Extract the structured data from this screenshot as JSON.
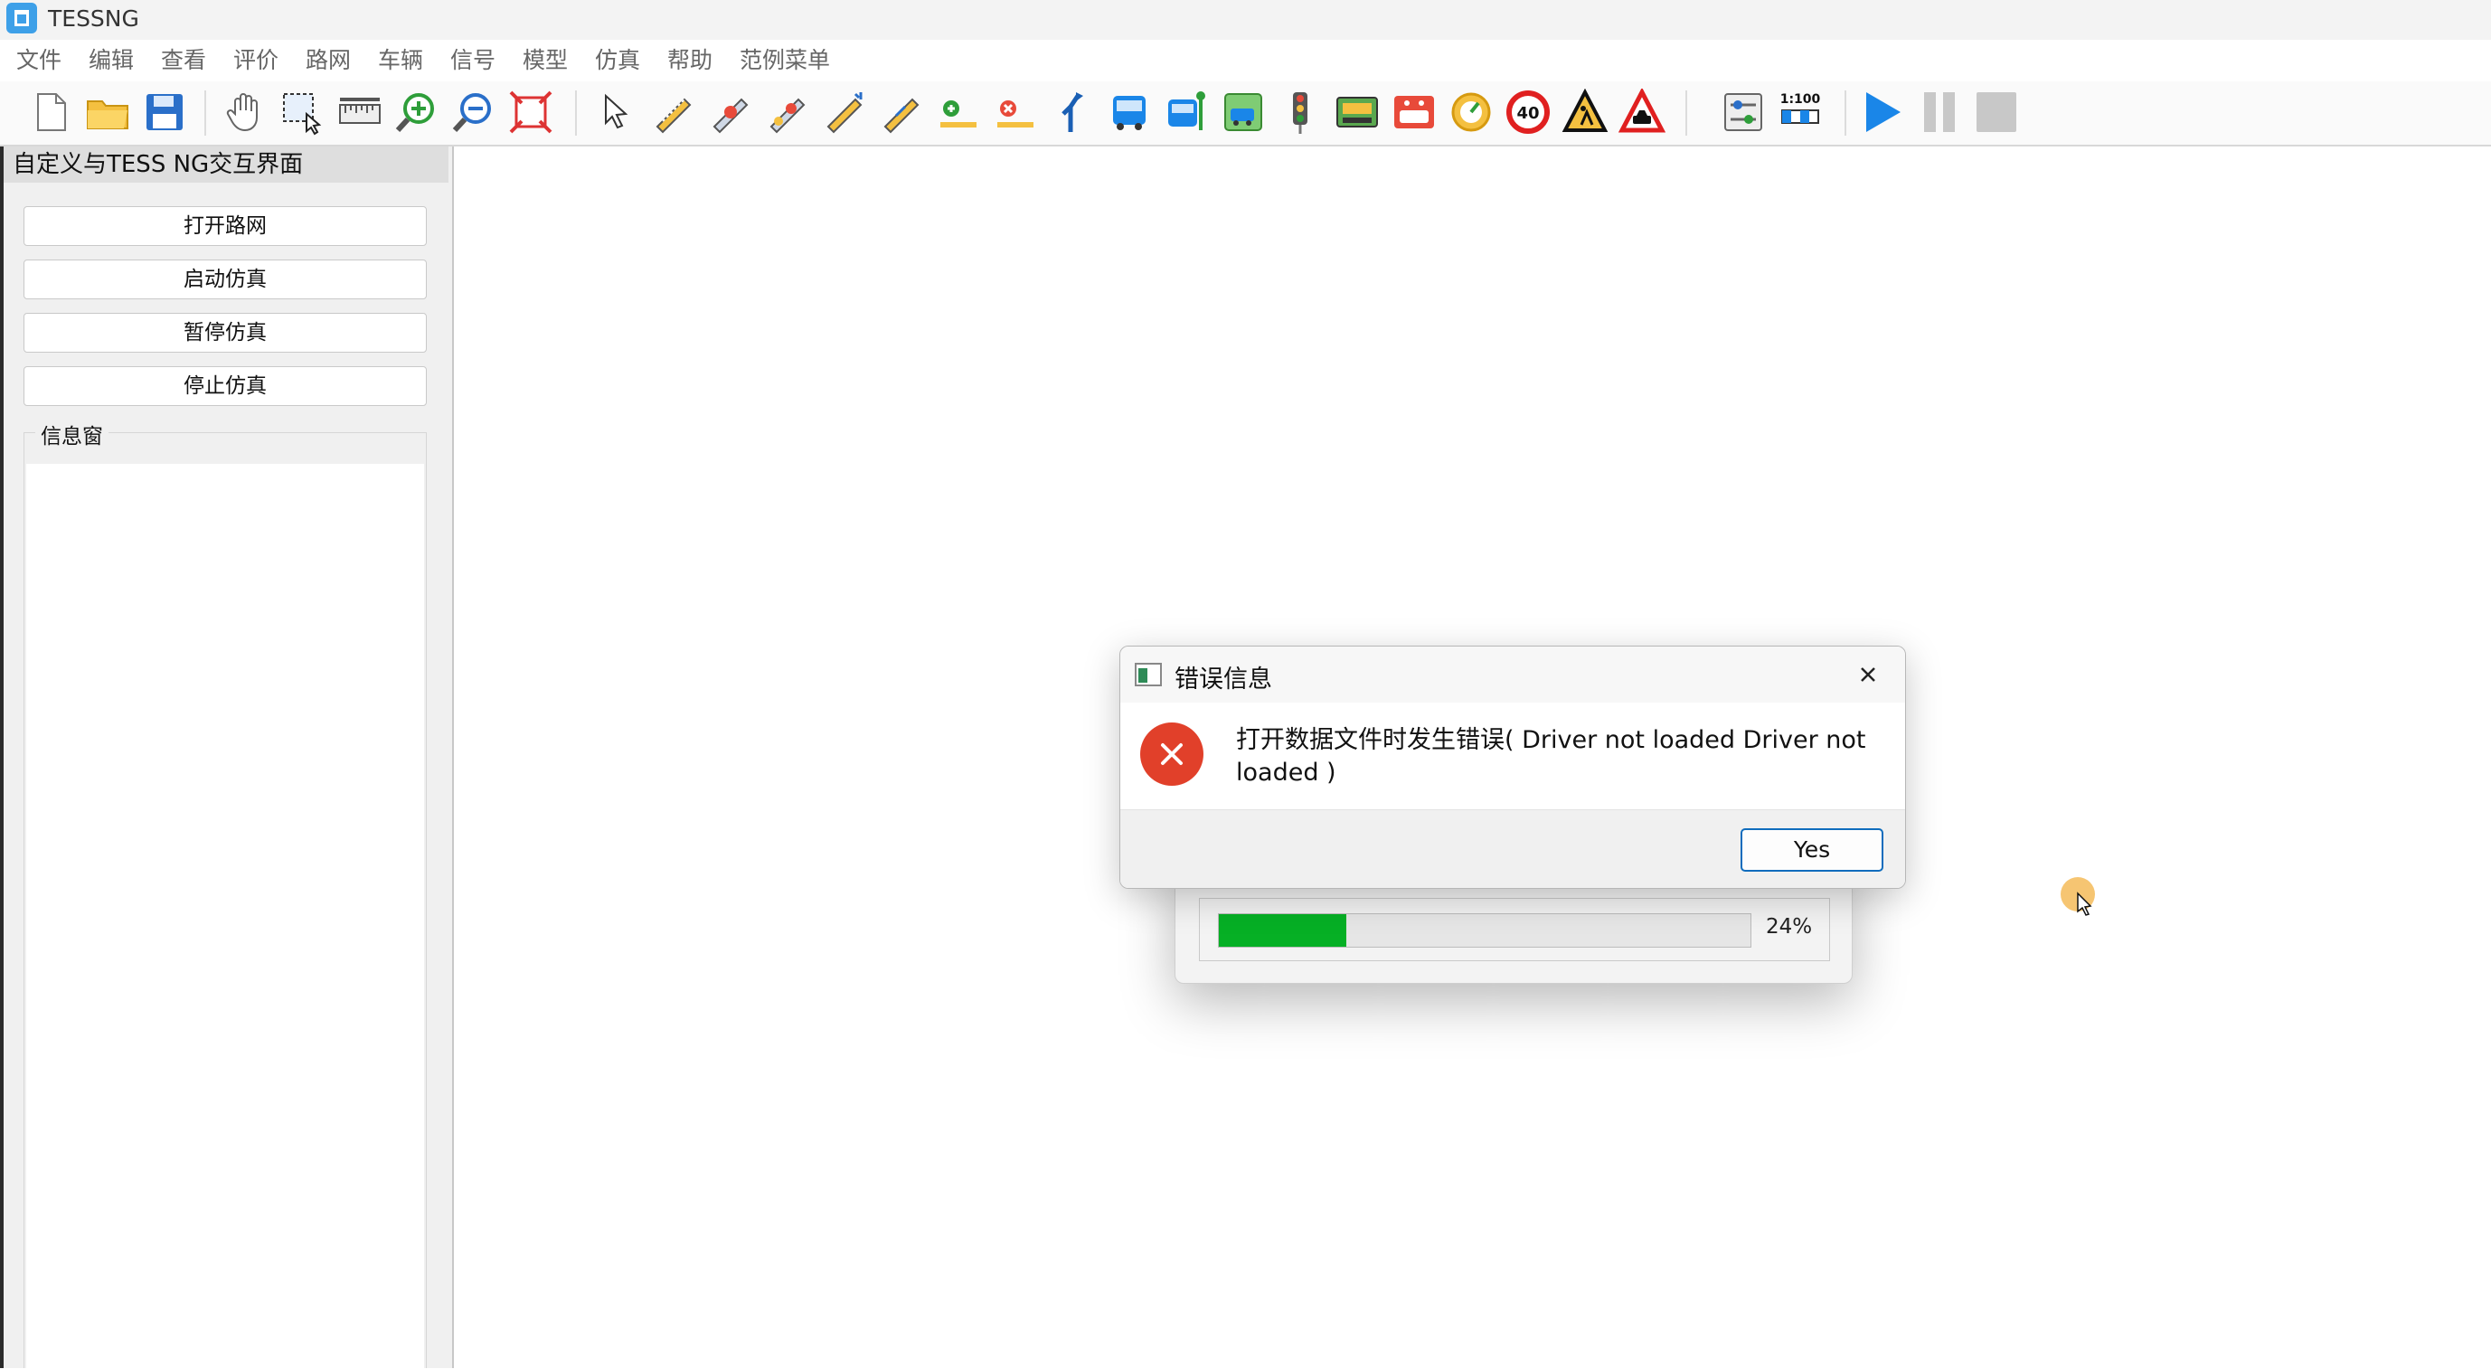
{
  "window": {
    "title": "TESSNG"
  },
  "menu": [
    "文件",
    "编辑",
    "查看",
    "评价",
    "路网",
    "车辆",
    "信号",
    "模型",
    "仿真",
    "帮助",
    "范例菜单"
  ],
  "toolbar": {
    "scale_label": "1:100",
    "speed_limit": "40"
  },
  "left_panel": {
    "title": "自定义与TESS NG交互界面",
    "buttons": [
      "打开路网",
      "启动仿真",
      "暂停仿真",
      "停止仿真"
    ],
    "info_label": "信息窗",
    "info_text": ""
  },
  "progress": {
    "value": 24,
    "label": "24%"
  },
  "error_dialog": {
    "title": "错误信息",
    "message": "打开数据文件时发生错误( Driver not loaded Driver not loaded )",
    "yes_label": "Yes"
  },
  "colors": {
    "progress_fill": "#06b025",
    "error_icon": "#e1402a",
    "play_icon": "#1a86e8",
    "accent": "#0f6cbd"
  }
}
